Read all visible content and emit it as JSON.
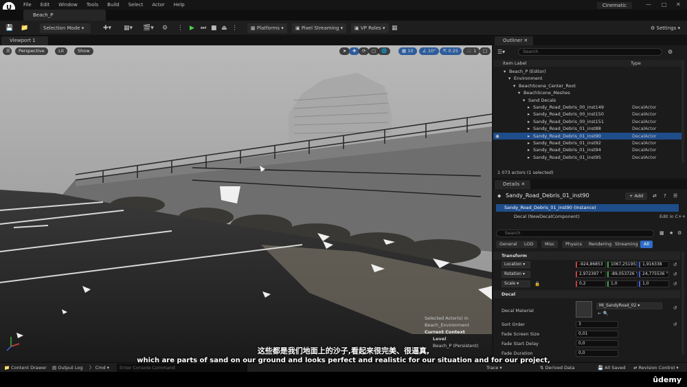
{
  "menu": [
    "File",
    "Edit",
    "Window",
    "Tools",
    "Build",
    "Select",
    "Actor",
    "Help"
  ],
  "level_tab": "Beach_P",
  "cinematic_label": "Cinematic",
  "toolbar": {
    "selection_mode": "Selection Mode",
    "platforms": "Platforms",
    "pixel_streaming": "Pixel Streaming",
    "vp_roles": "VP Roles",
    "settings": "Settings"
  },
  "viewport": {
    "tab": "Viewport 1",
    "perspective": "Perspective",
    "lit": "Lit",
    "show": "Show",
    "grid_snap": "10",
    "rot_snap": "10°",
    "scale_snap": "0.25",
    "camera_speed": "1",
    "selected_info": "Selected Actor(s) in",
    "env": "Beach_Environment",
    "current_context": "Current Context",
    "level": "Level",
    "persistent": "Beach_P (Persistent)"
  },
  "outliner": {
    "title": "Outliner",
    "search_placeholder": "Search",
    "col_label": "Item Label",
    "col_type": "Type",
    "rows": [
      {
        "label": "Beach_P (Editor)",
        "type": "",
        "indent": 1
      },
      {
        "label": "Environment",
        "type": "",
        "indent": 2
      },
      {
        "label": "BeachScene_Center_Root",
        "type": "",
        "indent": 3
      },
      {
        "label": "BeachScene_Meshes",
        "type": "",
        "indent": 4
      },
      {
        "label": "Sand Decals",
        "type": "",
        "indent": 5
      },
      {
        "label": "Sandy_Road_Debris_00_inst149",
        "type": "DecalActor",
        "indent": 6
      },
      {
        "label": "Sandy_Road_Debris_00_inst150",
        "type": "DecalActor",
        "indent": 6
      },
      {
        "label": "Sandy_Road_Debris_00_inst151",
        "type": "DecalActor",
        "indent": 6
      },
      {
        "label": "Sandy_Road_Debris_01_inst88",
        "type": "DecalActor",
        "indent": 6
      },
      {
        "label": "Sandy_Road_Debris_01_inst90",
        "type": "DecalActor",
        "indent": 6,
        "selected": true
      },
      {
        "label": "Sandy_Road_Debris_01_inst92",
        "type": "DecalActor",
        "indent": 6
      },
      {
        "label": "Sandy_Road_Debris_01_inst94",
        "type": "DecalActor",
        "indent": 6
      },
      {
        "label": "Sandy_Road_Debris_01_inst95",
        "type": "DecalActor",
        "indent": 6
      }
    ],
    "status": "1 073 actors (1 selected)"
  },
  "details": {
    "title": "Details",
    "actor_name": "Sandy_Road_Debris_01_inst90",
    "add_label": "+ Add",
    "instance": "Sandy_Road_Debris_01_inst90 (Instance)",
    "component": "Decal (NewDecalComponent)",
    "edit_cpp": "Edit in C++",
    "search_placeholder": "Search",
    "categories": [
      "General",
      "LOD",
      "Misc",
      "Physics",
      "Rendering",
      "Streaming",
      "All"
    ],
    "transform_label": "Transform",
    "location_label": "Location",
    "location": [
      "-924,86853",
      "1067,251953",
      "1,916338"
    ],
    "rotation_label": "Rotation",
    "rotation": [
      "2,972397 °",
      "-89,053726 °",
      "24,775536 °"
    ],
    "scale_label": "Scale",
    "scale": [
      "0,2",
      "1,0",
      "1,0"
    ],
    "decal_label": "Decal",
    "decal_material_label": "Decal Material",
    "decal_material": "MI_SandyRoad_02",
    "sort_order_label": "Sort Order",
    "sort_order": "3",
    "fade_screen_size_label": "Fade Screen Size",
    "fade_screen_size": "0,01",
    "fade_start_delay_label": "Fade Start Delay",
    "fade_start_delay": "0,0",
    "fade_duration_label": "Fade Duration",
    "fade_duration": "0,0"
  },
  "bottom": {
    "content_drawer": "Content Drawer",
    "output_log": "Output Log",
    "cmd": "Cmd",
    "console_placeholder": "Enter Console Command",
    "trace": "Trace",
    "derived_data": "Derived Data",
    "all_saved": "All Saved",
    "revision_control": "Revision Control"
  },
  "subtitle_cn": "这些都是我们地面上的沙子,看起来很完美、很逼真,",
  "subtitle_en": "which are parts of sand on our ground and looks perfect and realistic for our situation and for our project,",
  "watermark": "ûdemy",
  "colors": {
    "accent": "#2f6cc7",
    "selected_row": "#1f4d8a",
    "play": "#4bd44b"
  }
}
